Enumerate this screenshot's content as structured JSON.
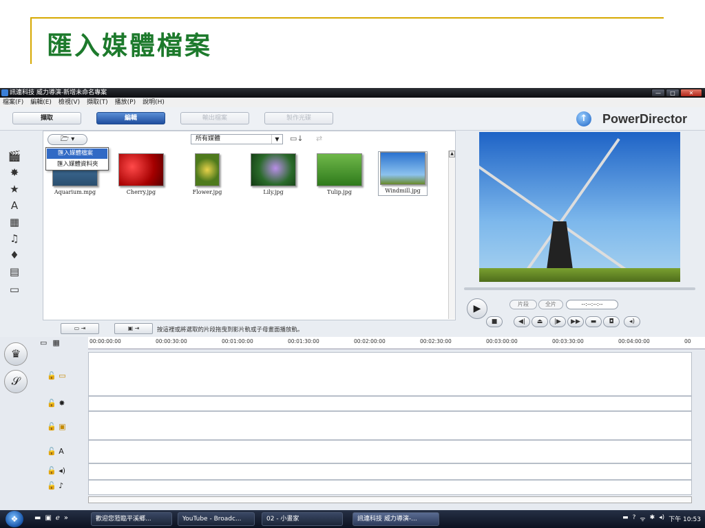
{
  "slide": {
    "title": "匯入媒體檔案"
  },
  "window": {
    "title": "訊連科技 威力導演-新增未命名專案",
    "buttons": {
      "minimize": "—",
      "maximize": "□",
      "close": "✕"
    }
  },
  "menu": [
    "檔案(F)",
    "編輯(E)",
    "檢視(V)",
    "擷取(T)",
    "播放(P)",
    "說明(H)"
  ],
  "modes": [
    "擷取",
    "編輯",
    "輸出檔案",
    "製作光碟"
  ],
  "brand": {
    "name": "PowerDirector"
  },
  "library": {
    "filter_selected": "所有媒體",
    "import_menu": [
      "匯入媒體檔案",
      "匯入媒體資料夾"
    ],
    "files": [
      "Aquarium.mpg",
      "Cherry.jpg",
      "Flower.jpg",
      "Lily.jpg",
      "Tulip.jpg",
      "Windmill.jpg"
    ],
    "hint": "按這裡或將選取的片段拖曳到影片軌或子母畫面播放軌。"
  },
  "player": {
    "clip_label": "片段",
    "movie_label": "全片",
    "timecode": "--:--:--:--"
  },
  "timeline": {
    "ticks": [
      "00:00:00:00",
      "00:00:30:00",
      "00:01:00:00",
      "00:01:30:00",
      "00:02:00:00",
      "00:02:30:00",
      "00:03:00:00",
      "00:03:30:00",
      "00:04:00:00",
      "00"
    ]
  },
  "taskbar": {
    "items": [
      "歡迎您蒞臨平溪鄉...",
      "YouTube - Broadc...",
      "02 - 小畫家",
      "訊連科技 威力導演-..."
    ],
    "clock": "下午 10:53"
  },
  "icons": {
    "import": "folder-icon",
    "capture": "clapper-icon",
    "effect": "effect-icon",
    "pip": "pip-icon",
    "title": "text-icon",
    "transition": "transition-icon",
    "audio": "music-icon",
    "mic": "mic-icon",
    "chapter": "chapter-icon",
    "subtitle": "subtitle-icon"
  },
  "colors": {
    "title_green": "#1d7a2c",
    "accent_gold": "#d6a800",
    "active_mode": "#1f4e9e"
  }
}
